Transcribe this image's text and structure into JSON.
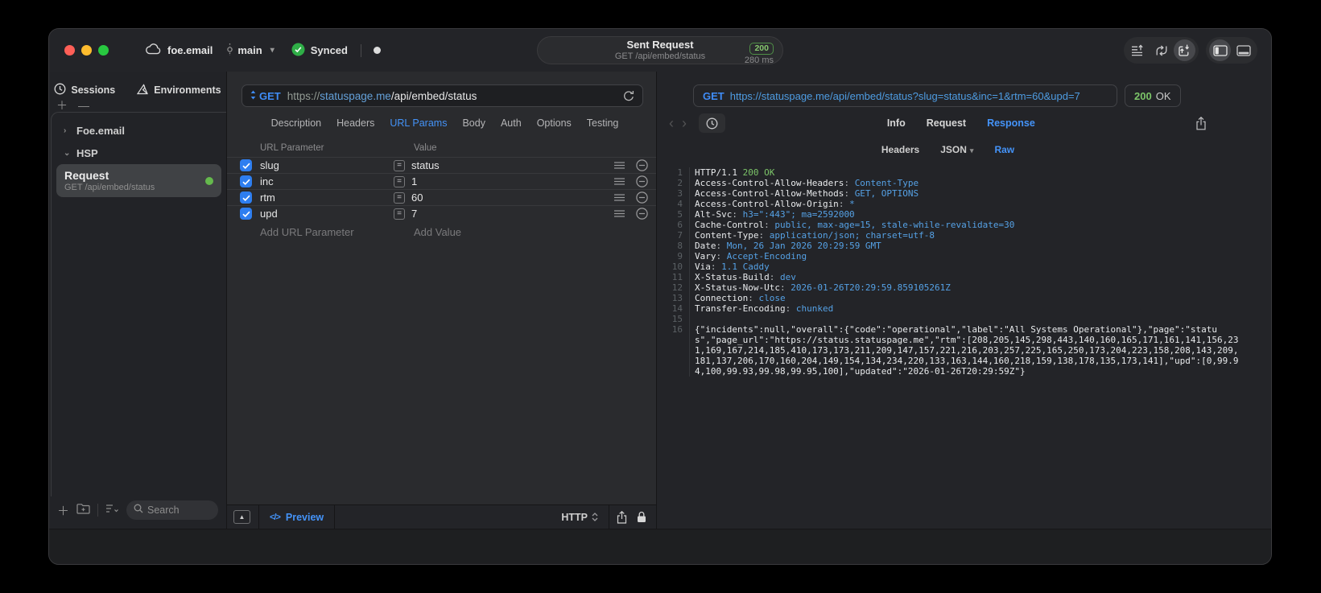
{
  "colors": {
    "accent_blue": "#4493f8",
    "method_blue": "#3f8cf6",
    "status_green": "#7cc569",
    "checkbox_blue": "#2e7ef0"
  },
  "titlebar": {
    "project": "foe.email",
    "branch": "main",
    "sync_status": "Synced",
    "center": {
      "title": "Sent Request",
      "subtitle": "GET /api/embed/status",
      "status_code": "200",
      "duration": "280 ms"
    }
  },
  "sidebar": {
    "tabs": [
      {
        "label": "Sessions"
      },
      {
        "label": "Environments"
      }
    ],
    "tree": [
      {
        "label": "Foe.email",
        "chevron": "›"
      },
      {
        "label": "HSP",
        "chevron": "⌄"
      }
    ],
    "request": {
      "title": "Request",
      "subtitle": "GET /api/embed/status"
    },
    "search_placeholder": "Search"
  },
  "request_editor": {
    "method": "GET",
    "url_scheme": "https://",
    "url_host": "statuspage.me",
    "url_path": "/api/embed/status",
    "tabs": [
      "Description",
      "Headers",
      "URL Params",
      "Body",
      "Auth",
      "Options",
      "Testing"
    ],
    "active_tab": "URL Params",
    "table": {
      "col_param": "URL Parameter",
      "col_value": "Value",
      "rows": [
        {
          "name": "slug",
          "value": "status"
        },
        {
          "name": "inc",
          "value": "1"
        },
        {
          "name": "rtm",
          "value": "60"
        },
        {
          "name": "upd",
          "value": "7"
        }
      ],
      "add_param": "Add URL Parameter",
      "add_value": "Add Value"
    },
    "footer": {
      "preview": "Preview",
      "protocol": "HTTP"
    }
  },
  "response_viewer": {
    "method": "GET",
    "url": "https://statuspage.me/api/embed/status?slug=status&inc=1&rtm=60&upd=7",
    "status_code": "200",
    "status_text": "OK",
    "tabs": [
      "Info",
      "Request",
      "Response"
    ],
    "active_tab": "Response",
    "subtabs": [
      "Headers",
      "JSON",
      "Raw"
    ],
    "active_subtab": "Raw",
    "lines": [
      {
        "no": "1",
        "segs": [
          {
            "c": "k",
            "t": "HTTP/1.1 "
          },
          {
            "c": "g",
            "t": "200 OK"
          }
        ]
      },
      {
        "no": "2",
        "segs": [
          {
            "c": "k",
            "t": "Access-Control-Allow-Headers"
          },
          {
            "c": "d",
            "t": ": "
          },
          {
            "c": "v",
            "t": "Content-Type"
          }
        ]
      },
      {
        "no": "3",
        "segs": [
          {
            "c": "k",
            "t": "Access-Control-Allow-Methods"
          },
          {
            "c": "d",
            "t": ": "
          },
          {
            "c": "v",
            "t": "GET, OPTIONS"
          }
        ]
      },
      {
        "no": "4",
        "segs": [
          {
            "c": "k",
            "t": "Access-Control-Allow-Origin"
          },
          {
            "c": "d",
            "t": ": "
          },
          {
            "c": "v",
            "t": "*"
          }
        ]
      },
      {
        "no": "5",
        "segs": [
          {
            "c": "k",
            "t": "Alt-Svc"
          },
          {
            "c": "d",
            "t": ": "
          },
          {
            "c": "v",
            "t": "h3=\":443\"; ma=2592000"
          }
        ]
      },
      {
        "no": "6",
        "segs": [
          {
            "c": "k",
            "t": "Cache-Control"
          },
          {
            "c": "d",
            "t": ": "
          },
          {
            "c": "v",
            "t": "public, max-age=15, stale-while-revalidate=30"
          }
        ]
      },
      {
        "no": "7",
        "segs": [
          {
            "c": "k",
            "t": "Content-Type"
          },
          {
            "c": "d",
            "t": ": "
          },
          {
            "c": "v",
            "t": "application/json; charset=utf-8"
          }
        ]
      },
      {
        "no": "8",
        "segs": [
          {
            "c": "k",
            "t": "Date"
          },
          {
            "c": "d",
            "t": ": "
          },
          {
            "c": "v",
            "t": "Mon, 26 Jan 2026 20:29:59 GMT"
          }
        ]
      },
      {
        "no": "9",
        "segs": [
          {
            "c": "k",
            "t": "Vary"
          },
          {
            "c": "d",
            "t": ": "
          },
          {
            "c": "v",
            "t": "Accept-Encoding"
          }
        ]
      },
      {
        "no": "10",
        "segs": [
          {
            "c": "k",
            "t": "Via"
          },
          {
            "c": "d",
            "t": ": "
          },
          {
            "c": "v",
            "t": "1.1 Caddy"
          }
        ]
      },
      {
        "no": "11",
        "segs": [
          {
            "c": "k",
            "t": "X-Status-Build"
          },
          {
            "c": "d",
            "t": ": "
          },
          {
            "c": "v",
            "t": "dev"
          }
        ]
      },
      {
        "no": "12",
        "segs": [
          {
            "c": "k",
            "t": "X-Status-Now-Utc"
          },
          {
            "c": "d",
            "t": ": "
          },
          {
            "c": "v",
            "t": "2026-01-26T20:29:59.859105261Z"
          }
        ]
      },
      {
        "no": "13",
        "segs": [
          {
            "c": "k",
            "t": "Connection"
          },
          {
            "c": "d",
            "t": ": "
          },
          {
            "c": "v",
            "t": "close"
          }
        ]
      },
      {
        "no": "14",
        "segs": [
          {
            "c": "k",
            "t": "Transfer-Encoding"
          },
          {
            "c": "d",
            "t": ": "
          },
          {
            "c": "v",
            "t": "chunked"
          }
        ]
      },
      {
        "no": "15",
        "segs": []
      },
      {
        "no": "16",
        "segs": [
          {
            "c": "k",
            "t": "{\"incidents\":null,\"overall\":{\"code\":\"operational\",\"label\":\"All Systems Operational\"},\"page\":\"status\",\"page_url\":\"https://status.statuspage.me\",\"rtm\":[208,205,145,298,443,140,160,165,171,161,141,156,231,169,167,214,185,410,173,173,211,209,147,157,221,216,203,257,225,165,250,173,204,223,158,208,143,209,181,137,206,170,160,204,149,154,134,234,220,133,163,144,160,218,159,138,178,135,173,141],\"upd\":[0,99.94,100,99.93,99.98,99.95,100],\"updated\":\"2026-01-26T20:29:59Z\"}"
          }
        ]
      }
    ]
  }
}
